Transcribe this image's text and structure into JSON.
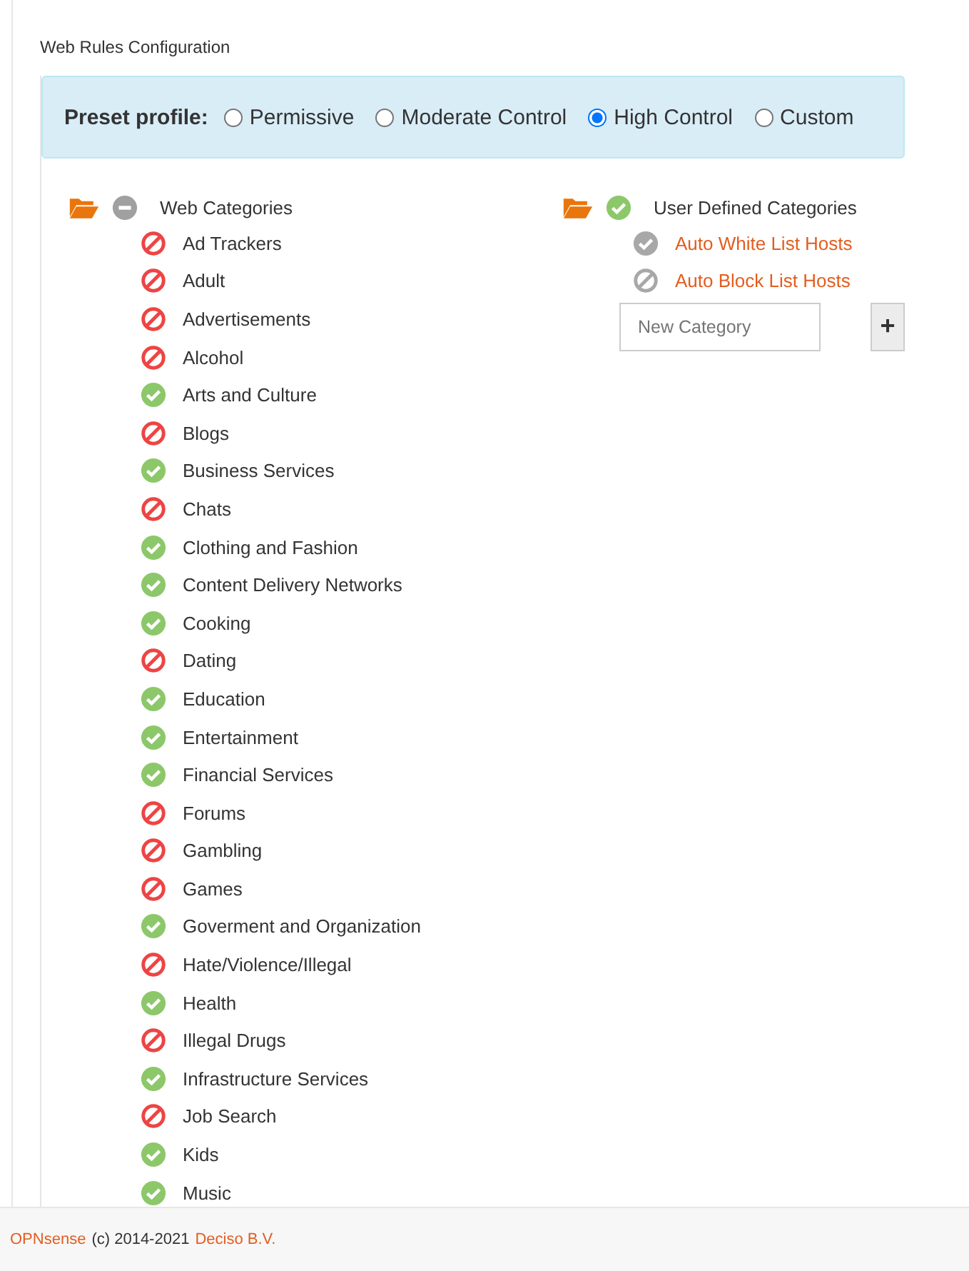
{
  "section_title": "Web Rules Configuration",
  "preset": {
    "label": "Preset profile:",
    "options": [
      {
        "label": "Permissive",
        "selected": false
      },
      {
        "label": "Moderate Control",
        "selected": false
      },
      {
        "label": "High Control",
        "selected": true
      },
      {
        "label": "Custom",
        "selected": false
      }
    ]
  },
  "web_categories": {
    "label": "Web Categories",
    "kind": "partial",
    "children": [
      {
        "label": "Ad Trackers",
        "kind": "blocked"
      },
      {
        "label": "Adult",
        "kind": "blocked"
      },
      {
        "label": "Advertisements",
        "kind": "blocked"
      },
      {
        "label": "Alcohol",
        "kind": "blocked"
      },
      {
        "label": "Arts and Culture",
        "kind": "allowed"
      },
      {
        "label": "Blogs",
        "kind": "blocked"
      },
      {
        "label": "Business Services",
        "kind": "allowed"
      },
      {
        "label": "Chats",
        "kind": "blocked"
      },
      {
        "label": "Clothing and Fashion",
        "kind": "allowed"
      },
      {
        "label": "Content Delivery Networks",
        "kind": "allowed"
      },
      {
        "label": "Cooking",
        "kind": "allowed"
      },
      {
        "label": "Dating",
        "kind": "blocked"
      },
      {
        "label": "Education",
        "kind": "allowed"
      },
      {
        "label": "Entertainment",
        "kind": "allowed"
      },
      {
        "label": "Financial Services",
        "kind": "allowed"
      },
      {
        "label": "Forums",
        "kind": "blocked"
      },
      {
        "label": "Gambling",
        "kind": "blocked"
      },
      {
        "label": "Games",
        "kind": "blocked"
      },
      {
        "label": "Goverment and Organization",
        "kind": "allowed"
      },
      {
        "label": "Hate/Violence/Illegal",
        "kind": "blocked"
      },
      {
        "label": "Health",
        "kind": "allowed"
      },
      {
        "label": "Illegal Drugs",
        "kind": "blocked"
      },
      {
        "label": "Infrastructure Services",
        "kind": "allowed"
      },
      {
        "label": "Job Search",
        "kind": "blocked"
      },
      {
        "label": "Kids",
        "kind": "allowed"
      },
      {
        "label": "Music",
        "kind": "allowed"
      }
    ]
  },
  "user_categories": {
    "label": "User Defined Categories",
    "kind": "allowed",
    "children": [
      {
        "label": "Auto White List Hosts",
        "kind": "allowed-inactive"
      },
      {
        "label": "Auto Block List Hosts",
        "kind": "blocked-inactive"
      }
    ]
  },
  "new_category": {
    "placeholder": "New Category"
  },
  "add_button": "+",
  "footer": {
    "brand": "OPNsense",
    "copyright": "(c) 2014-2021",
    "company": "Deciso B.V."
  }
}
